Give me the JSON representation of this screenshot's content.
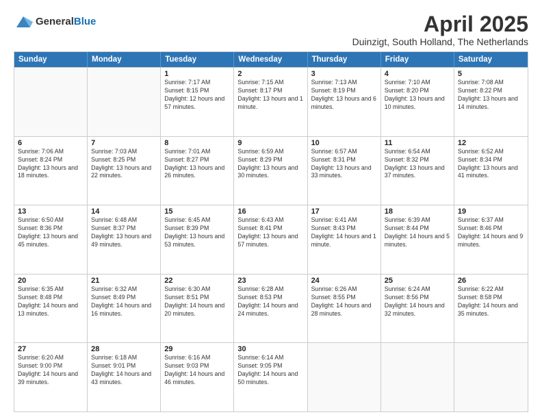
{
  "logo": {
    "general": "General",
    "blue": "Blue"
  },
  "title": "April 2025",
  "subtitle": "Duinzigt, South Holland, The Netherlands",
  "weekdays": [
    "Sunday",
    "Monday",
    "Tuesday",
    "Wednesday",
    "Thursday",
    "Friday",
    "Saturday"
  ],
  "rows": [
    [
      {
        "day": "",
        "info": ""
      },
      {
        "day": "",
        "info": ""
      },
      {
        "day": "1",
        "info": "Sunrise: 7:17 AM\nSunset: 8:15 PM\nDaylight: 12 hours and 57 minutes."
      },
      {
        "day": "2",
        "info": "Sunrise: 7:15 AM\nSunset: 8:17 PM\nDaylight: 13 hours and 1 minute."
      },
      {
        "day": "3",
        "info": "Sunrise: 7:13 AM\nSunset: 8:19 PM\nDaylight: 13 hours and 6 minutes."
      },
      {
        "day": "4",
        "info": "Sunrise: 7:10 AM\nSunset: 8:20 PM\nDaylight: 13 hours and 10 minutes."
      },
      {
        "day": "5",
        "info": "Sunrise: 7:08 AM\nSunset: 8:22 PM\nDaylight: 13 hours and 14 minutes."
      }
    ],
    [
      {
        "day": "6",
        "info": "Sunrise: 7:06 AM\nSunset: 8:24 PM\nDaylight: 13 hours and 18 minutes."
      },
      {
        "day": "7",
        "info": "Sunrise: 7:03 AM\nSunset: 8:25 PM\nDaylight: 13 hours and 22 minutes."
      },
      {
        "day": "8",
        "info": "Sunrise: 7:01 AM\nSunset: 8:27 PM\nDaylight: 13 hours and 26 minutes."
      },
      {
        "day": "9",
        "info": "Sunrise: 6:59 AM\nSunset: 8:29 PM\nDaylight: 13 hours and 30 minutes."
      },
      {
        "day": "10",
        "info": "Sunrise: 6:57 AM\nSunset: 8:31 PM\nDaylight: 13 hours and 33 minutes."
      },
      {
        "day": "11",
        "info": "Sunrise: 6:54 AM\nSunset: 8:32 PM\nDaylight: 13 hours and 37 minutes."
      },
      {
        "day": "12",
        "info": "Sunrise: 6:52 AM\nSunset: 8:34 PM\nDaylight: 13 hours and 41 minutes."
      }
    ],
    [
      {
        "day": "13",
        "info": "Sunrise: 6:50 AM\nSunset: 8:36 PM\nDaylight: 13 hours and 45 minutes."
      },
      {
        "day": "14",
        "info": "Sunrise: 6:48 AM\nSunset: 8:37 PM\nDaylight: 13 hours and 49 minutes."
      },
      {
        "day": "15",
        "info": "Sunrise: 6:45 AM\nSunset: 8:39 PM\nDaylight: 13 hours and 53 minutes."
      },
      {
        "day": "16",
        "info": "Sunrise: 6:43 AM\nSunset: 8:41 PM\nDaylight: 13 hours and 57 minutes."
      },
      {
        "day": "17",
        "info": "Sunrise: 6:41 AM\nSunset: 8:43 PM\nDaylight: 14 hours and 1 minute."
      },
      {
        "day": "18",
        "info": "Sunrise: 6:39 AM\nSunset: 8:44 PM\nDaylight: 14 hours and 5 minutes."
      },
      {
        "day": "19",
        "info": "Sunrise: 6:37 AM\nSunset: 8:46 PM\nDaylight: 14 hours and 9 minutes."
      }
    ],
    [
      {
        "day": "20",
        "info": "Sunrise: 6:35 AM\nSunset: 8:48 PM\nDaylight: 14 hours and 13 minutes."
      },
      {
        "day": "21",
        "info": "Sunrise: 6:32 AM\nSunset: 8:49 PM\nDaylight: 14 hours and 16 minutes."
      },
      {
        "day": "22",
        "info": "Sunrise: 6:30 AM\nSunset: 8:51 PM\nDaylight: 14 hours and 20 minutes."
      },
      {
        "day": "23",
        "info": "Sunrise: 6:28 AM\nSunset: 8:53 PM\nDaylight: 14 hours and 24 minutes."
      },
      {
        "day": "24",
        "info": "Sunrise: 6:26 AM\nSunset: 8:55 PM\nDaylight: 14 hours and 28 minutes."
      },
      {
        "day": "25",
        "info": "Sunrise: 6:24 AM\nSunset: 8:56 PM\nDaylight: 14 hours and 32 minutes."
      },
      {
        "day": "26",
        "info": "Sunrise: 6:22 AM\nSunset: 8:58 PM\nDaylight: 14 hours and 35 minutes."
      }
    ],
    [
      {
        "day": "27",
        "info": "Sunrise: 6:20 AM\nSunset: 9:00 PM\nDaylight: 14 hours and 39 minutes."
      },
      {
        "day": "28",
        "info": "Sunrise: 6:18 AM\nSunset: 9:01 PM\nDaylight: 14 hours and 43 minutes."
      },
      {
        "day": "29",
        "info": "Sunrise: 6:16 AM\nSunset: 9:03 PM\nDaylight: 14 hours and 46 minutes."
      },
      {
        "day": "30",
        "info": "Sunrise: 6:14 AM\nSunset: 9:05 PM\nDaylight: 14 hours and 50 minutes."
      },
      {
        "day": "",
        "info": ""
      },
      {
        "day": "",
        "info": ""
      },
      {
        "day": "",
        "info": ""
      }
    ]
  ]
}
